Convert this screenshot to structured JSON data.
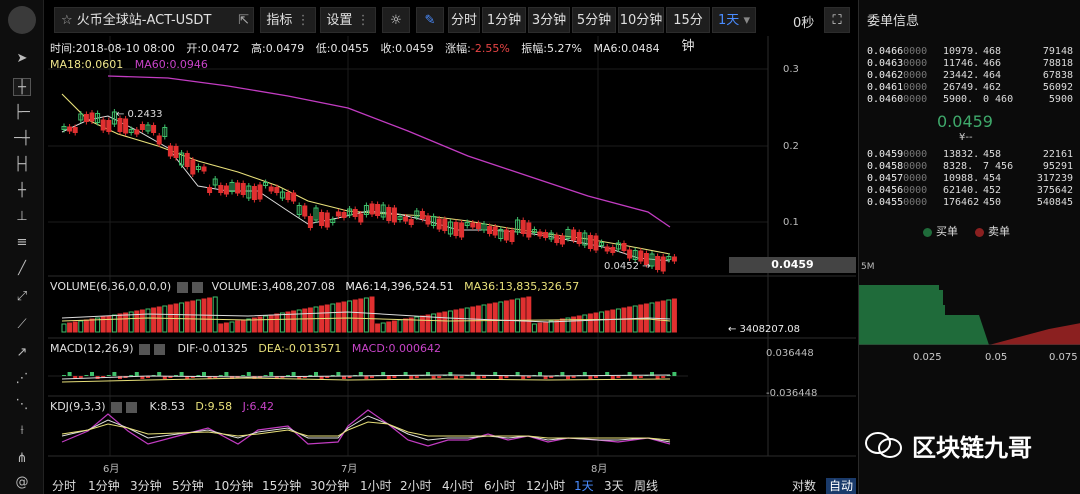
{
  "toolbar": {
    "symbol": "火币全球站-ACT-USDT",
    "indicators": "指标",
    "settings": "设置",
    "periods": [
      "分时",
      "1分钟",
      "3分钟",
      "5分钟",
      "10分钟",
      "15分钟"
    ],
    "selected_period": "1天",
    "timer": "0秒"
  },
  "ohlc": {
    "time": "时间:2018-08-10 08:00",
    "open": "开:0.0472",
    "high": "高:0.0479",
    "low": "低:0.0455",
    "close": "收:0.0459",
    "change_label": "涨幅:",
    "change_value": "-2.55%",
    "amplitude": "振幅:5.27%",
    "ma6": "MA6:0.0484",
    "ma18": "MA18:0.0601",
    "ma60": "MA60:0.0946"
  },
  "price_axis": [
    "0.3",
    "0.2",
    "0.1"
  ],
  "current_price_tag": "0.0459",
  "annotations": {
    "max": "← 0.2433",
    "min": "0.0452 →"
  },
  "volume": {
    "label": "VOLUME(6,36,0,0,0,0)",
    "volume": "VOLUME:3,408,207.08",
    "ma6": "MA6:14,396,524.51",
    "ma36": "MA36:13,835,326.57",
    "last": "← 3408207.08"
  },
  "macd": {
    "label": "MACD(12,26,9)",
    "dif": "DIF:-0.01325",
    "dea": "DEA:-0.013571",
    "macd": "MACD:0.000642",
    "axis_top": "0.036448",
    "axis_bottom": "-0.036448"
  },
  "kdj": {
    "label": "KDJ(9,3,3)",
    "k": "K:8.53",
    "d": "D:9.58",
    "j": "J:6.42"
  },
  "time_axis": [
    "6月",
    "7月",
    "8月"
  ],
  "bottom_periods": [
    "分时",
    "1分钟",
    "3分钟",
    "5分钟",
    "10分钟",
    "15分钟",
    "30分钟",
    "1小时",
    "2小时",
    "4小时",
    "6小时",
    "12小时",
    "1天",
    "3天",
    "周线"
  ],
  "bottom_selected": "1天",
  "bottom_right": [
    "对数",
    "自动"
  ],
  "orderbook": {
    "title": "委单信息",
    "asks": [
      {
        "price": "0.0466",
        "price_zeros": "0000",
        "vol": "10979.",
        "vol2": "468",
        "total": "79148"
      },
      {
        "price": "0.0463",
        "price_zeros": "0000",
        "vol": "11746.",
        "vol2": "466",
        "total": "78818"
      },
      {
        "price": "0.0462",
        "price_zeros": "0000",
        "vol": "23442.",
        "vol2": "464",
        "total": "67838"
      },
      {
        "price": "0.0461",
        "price_zeros": "0000",
        "vol": "26749.",
        "vol2": "462",
        "total": "56092"
      },
      {
        "price": "0.0460",
        "price_zeros": "0000",
        "vol": "5900.",
        "vol2": "0 460",
        "total": "5900"
      }
    ],
    "last_price": "0.0459",
    "last_cny": "¥--",
    "bids": [
      {
        "price": "0.0459",
        "price_zeros": "0000",
        "vol": "13832.",
        "vol2": "458",
        "total": "22161"
      },
      {
        "price": "0.0458",
        "price_zeros": "0000",
        "vol": "8328.",
        "vol2": "7 456",
        "total": "95291"
      },
      {
        "price": "0.0457",
        "price_zeros": "0000",
        "vol": "10988.",
        "vol2": "454",
        "total": "317239"
      },
      {
        "price": "0.0456",
        "price_zeros": "0000",
        "vol": "62140.",
        "vol2": "452",
        "total": "375642"
      },
      {
        "price": "0.0455",
        "price_zeros": "0000",
        "vol": "176462",
        "vol2": "450",
        "total": "540845"
      }
    ],
    "buy_label": "买单",
    "sell_label": "卖单",
    "depth_y_label": "5M",
    "depth_x": [
      "0.025",
      "0.05",
      "0.075"
    ],
    "buy_color": "#1f6b3a",
    "sell_color": "#8b2020"
  },
  "watermark": "区块链九哥"
}
